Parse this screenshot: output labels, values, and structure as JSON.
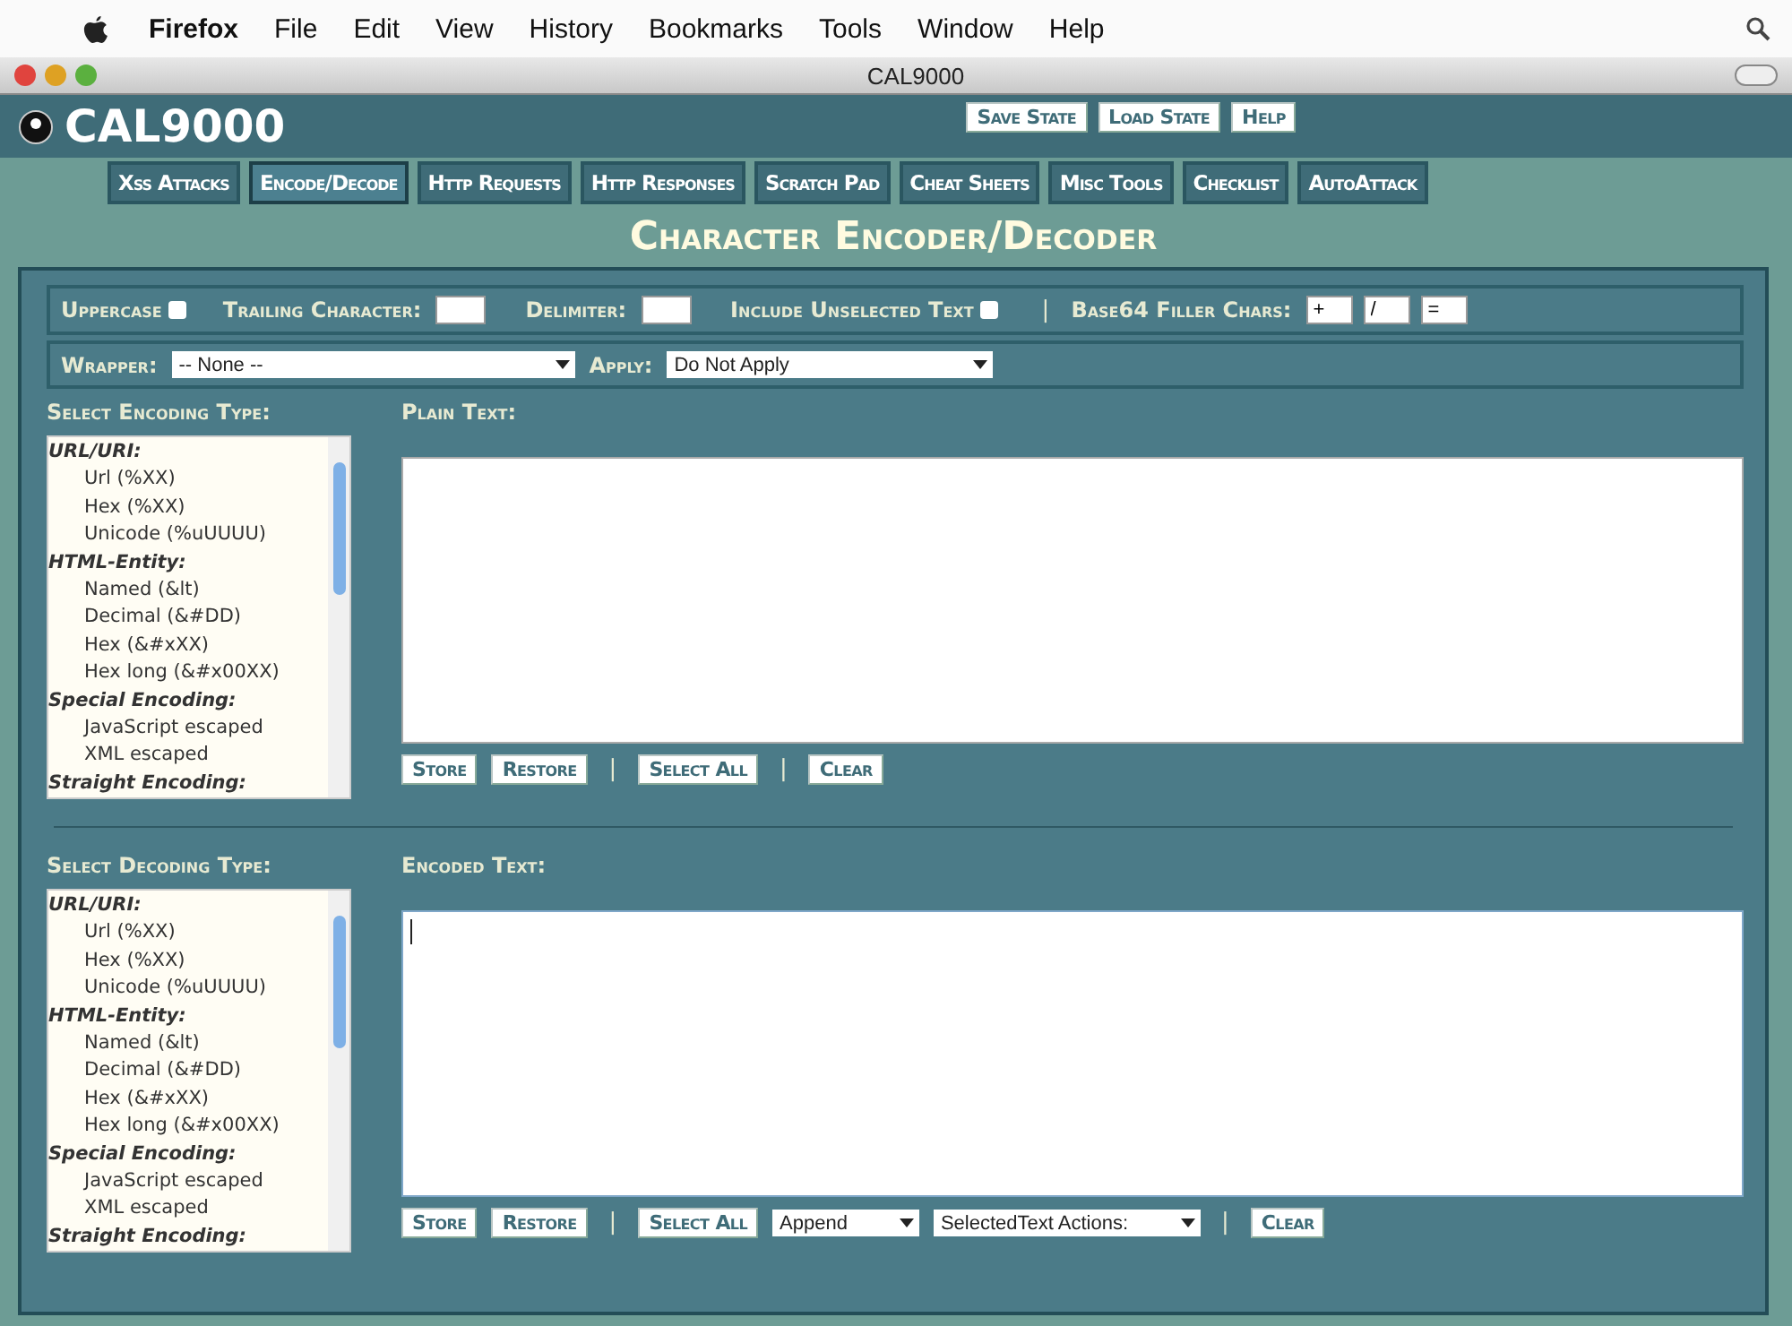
{
  "menu_bar": {
    "app": "Firefox",
    "items": [
      "File",
      "Edit",
      "View",
      "History",
      "Bookmarks",
      "Tools",
      "Window",
      "Help"
    ]
  },
  "window": {
    "title": "CAL9000"
  },
  "app": {
    "name": "CAL9000",
    "buttons": [
      "Save State",
      "Load State",
      "Help"
    ]
  },
  "nav": [
    {
      "label": "Xss Attacks",
      "selected": false
    },
    {
      "label": "Encode/Decode",
      "selected": true
    },
    {
      "label": "Http Requests",
      "selected": false
    },
    {
      "label": "Http Responses",
      "selected": false
    },
    {
      "label": "Scratch Pad",
      "selected": false
    },
    {
      "label": "Cheat Sheets",
      "selected": false
    },
    {
      "label": "Misc Tools",
      "selected": false
    },
    {
      "label": "Checklist",
      "selected": false
    },
    {
      "label": "AutoAttack",
      "selected": false
    }
  ],
  "page_title": "Character Encoder/Decoder",
  "options": {
    "uppercase": {
      "label": "Uppercase",
      "checked": false
    },
    "trailing_character": {
      "label": "Trailing Character:"
    },
    "delimiter": {
      "label": "Delimiter:"
    },
    "include_unselected": {
      "label": "Include Unselected Text",
      "checked": false
    },
    "separator": "|",
    "base64_filler": {
      "label": "Base64 Filler Chars:",
      "values": [
        "+",
        "/",
        "="
      ]
    },
    "wrapper": {
      "label": "Wrapper:",
      "value": "-- None --"
    },
    "apply": {
      "label": "Apply:",
      "value": "Do Not Apply"
    }
  },
  "sections": [
    {
      "type_label": "Select Encoding Type:",
      "text_label": "Plain Text:",
      "caret": false,
      "list": [
        {
          "kind": "group",
          "label": "URL/URI:"
        },
        {
          "kind": "item",
          "label": "Url (%XX)"
        },
        {
          "kind": "item",
          "label": "Hex (%XX)"
        },
        {
          "kind": "item",
          "label": "Unicode (%uUUUU)"
        },
        {
          "kind": "group",
          "label": "HTML-Entity:"
        },
        {
          "kind": "item",
          "label": "Named (&lt)"
        },
        {
          "kind": "item",
          "label": "Decimal (&#DD)"
        },
        {
          "kind": "item",
          "label": "Hex (&#xXX)"
        },
        {
          "kind": "item",
          "label": "Hex long (&#x00XX)"
        },
        {
          "kind": "group",
          "label": "Special Encoding:"
        },
        {
          "kind": "item",
          "label": "JavaScript escaped"
        },
        {
          "kind": "item",
          "label": "XML escaped"
        },
        {
          "kind": "group",
          "label": "Straight Encoding:"
        }
      ],
      "toolbar": [
        {
          "kind": "button",
          "label": "Store"
        },
        {
          "kind": "button",
          "label": "Restore"
        },
        {
          "kind": "separator",
          "label": "|"
        },
        {
          "kind": "button",
          "label": "Select All"
        },
        {
          "kind": "separator",
          "label": "|"
        },
        {
          "kind": "button",
          "label": "Clear"
        }
      ]
    },
    {
      "type_label": "Select Decoding Type:",
      "text_label": "Encoded Text:",
      "caret": true,
      "list": [
        {
          "kind": "group",
          "label": "URL/URI:"
        },
        {
          "kind": "item",
          "label": "Url (%XX)"
        },
        {
          "kind": "item",
          "label": "Hex (%XX)"
        },
        {
          "kind": "item",
          "label": "Unicode (%uUUUU)"
        },
        {
          "kind": "group",
          "label": "HTML-Entity:"
        },
        {
          "kind": "item",
          "label": "Named (&lt)"
        },
        {
          "kind": "item",
          "label": "Decimal (&#DD)"
        },
        {
          "kind": "item",
          "label": "Hex (&#xXX)"
        },
        {
          "kind": "item",
          "label": "Hex long (&#x00XX)"
        },
        {
          "kind": "group",
          "label": "Special Encoding:"
        },
        {
          "kind": "item",
          "label": "JavaScript escaped"
        },
        {
          "kind": "item",
          "label": "XML escaped"
        },
        {
          "kind": "group",
          "label": "Straight Encoding:"
        }
      ],
      "toolbar": [
        {
          "kind": "button",
          "label": "Store"
        },
        {
          "kind": "button",
          "label": "Restore"
        },
        {
          "kind": "separator",
          "label": "|"
        },
        {
          "kind": "button",
          "label": "Select All"
        },
        {
          "kind": "select",
          "label": "Append"
        },
        {
          "kind": "select",
          "label": "SelectedText Actions:"
        },
        {
          "kind": "separator",
          "label": "|"
        },
        {
          "kind": "button",
          "label": "Clear"
        }
      ]
    }
  ]
}
